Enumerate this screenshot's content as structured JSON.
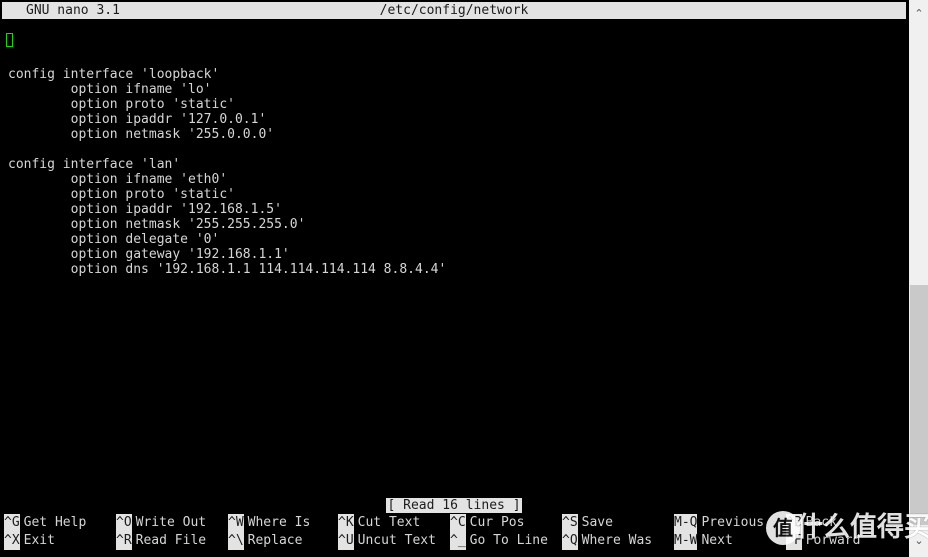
{
  "window": {
    "app_title": "GNU nano 3.1",
    "file_path": "/etc/config/network"
  },
  "editor": {
    "cursor_icon": "text-cursor-block",
    "cursor_color": "#23d018",
    "lines": [
      "",
      "config interface 'loopback'",
      "        option ifname 'lo'",
      "        option proto 'static'",
      "        option ipaddr '127.0.0.1'",
      "        option netmask '255.0.0.0'",
      "",
      "config interface 'lan'",
      "        option ifname 'eth0'",
      "        option proto 'static'",
      "        option ipaddr '192.168.1.5'",
      "        option netmask '255.255.255.0'",
      "        option delegate '0'",
      "        option gateway '192.168.1.1'",
      "        option dns '192.168.1.1 114.114.114.114 8.8.4.4'"
    ]
  },
  "status": {
    "message": "[ Read 16 lines ]"
  },
  "shortcuts": {
    "row1": [
      {
        "key": "^G",
        "label": "Get Help"
      },
      {
        "key": "^O",
        "label": "Write Out"
      },
      {
        "key": "^W",
        "label": "Where Is"
      },
      {
        "key": "^K",
        "label": "Cut Text"
      },
      {
        "key": "^C",
        "label": "Cur Pos"
      },
      {
        "key": "^S",
        "label": "Save"
      },
      {
        "key": "M-Q",
        "label": "Previous"
      },
      {
        "key": "^B",
        "label": "Back"
      }
    ],
    "row2": [
      {
        "key": "^X",
        "label": "Exit"
      },
      {
        "key": "^R",
        "label": "Read File"
      },
      {
        "key": "^\\",
        "label": "Replace"
      },
      {
        "key": "^U",
        "label": "Uncut Text"
      },
      {
        "key": "^_",
        "label": "Go To Line"
      },
      {
        "key": "^Q",
        "label": "Where Was"
      },
      {
        "key": "M-W",
        "label": "Next"
      },
      {
        "key": "^F",
        "label": "Forward"
      }
    ]
  },
  "scrollbar": {
    "up_arrow_icon": "chevron-up-icon",
    "down_arrow_icon": "chevron-down-icon",
    "up_arrow_glyph": "⌃",
    "down_arrow_glyph": "⌄"
  },
  "watermark": {
    "badge_text": "值",
    "text": "什么值得买"
  },
  "colors": {
    "background": "#000000",
    "foreground": "#d6d6d6",
    "inverse_bg": "#e3e3e3",
    "inverse_fg": "#1c1c1c",
    "cursor": "#23d018",
    "scrollbar_track": "#f0f0f0",
    "scrollbar_thumb": "#c9c9c9"
  }
}
